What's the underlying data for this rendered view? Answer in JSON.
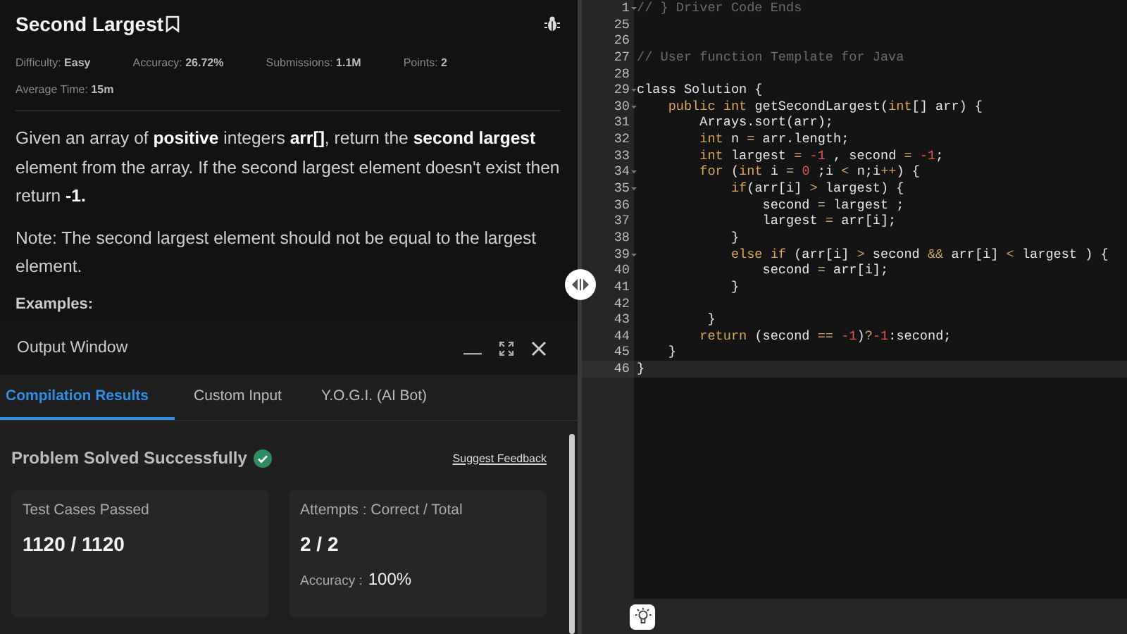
{
  "problem": {
    "title": "Second Largest",
    "meta": [
      {
        "label": "Difficulty:",
        "value": "Easy"
      },
      {
        "label": "Accuracy:",
        "value": "26.72%"
      },
      {
        "label": "Submissions:",
        "value": "1.1M"
      },
      {
        "label": "Points:",
        "value": "2"
      },
      {
        "label": "Average Time:",
        "value": "15m"
      }
    ],
    "paragraphs": [
      "Given an array of **positive** integers **arr[]**, return the **second largest** element from the array. If the second largest element doesn't exist then return **-1.**",
      "Note: The second largest element should not be equal to the largest element."
    ],
    "section_heading": "Examples:"
  },
  "output_window": {
    "title": "Output Window",
    "tabs": [
      {
        "label": "Compilation Results",
        "selected": true
      },
      {
        "label": "Custom Input",
        "selected": false
      },
      {
        "label": "Y.O.G.I. (AI Bot)",
        "selected": false
      }
    ],
    "status": "Problem Solved Successfully",
    "feedback_link": "Suggest Feedback",
    "cards": [
      {
        "label": "Test Cases Passed",
        "value": "1120 / 1120"
      },
      {
        "label": "Attempts : Correct / Total",
        "value": "2 / 2",
        "sub_label": "Accuracy :",
        "sub_value": "100%"
      }
    ]
  },
  "editor": {
    "lines": [
      {
        "n": "1",
        "fold": true,
        "current": false,
        "tokens": [
          {
            "color": "#6b6b6b",
            "t": "// } Driver Code Ends"
          }
        ]
      },
      {
        "n": "25",
        "fold": false,
        "current": false
      },
      {
        "n": "26",
        "fold": false,
        "current": false
      },
      {
        "n": "27",
        "fold": false,
        "current": false,
        "tokens": [
          {
            "color": "#6b6b6b",
            "t": "// User function Template for Java"
          }
        ]
      },
      {
        "n": "28",
        "fold": false,
        "current": false
      },
      {
        "n": "29",
        "fold": true,
        "current": false,
        "tokens": [
          {
            "color": "#e6e6e6",
            "t": "class Solution {"
          }
        ]
      },
      {
        "n": "30",
        "fold": true,
        "current": false,
        "tokens": [
          {
            "color": "#d9a95b",
            "t": "    public int"
          },
          {
            "color": "#e6e6e6",
            "t": " getSecondLargest("
          },
          {
            "color": "#d9a95b",
            "t": "int"
          },
          {
            "color": "#e6e6e6",
            "t": "[] arr) {"
          }
        ]
      },
      {
        "n": "31",
        "fold": false,
        "current": false,
        "tokens": [
          {
            "color": "#e6e6e6",
            "t": "        Arrays.sort(arr);"
          }
        ]
      },
      {
        "n": "32",
        "fold": false,
        "current": false,
        "tokens": [
          {
            "color": "#d9a95b",
            "t": "        int"
          },
          {
            "color": "#e6e6e6",
            "t": " n "
          },
          {
            "color": "#c9a36b",
            "t": "="
          },
          {
            "color": "#e6e6e6",
            "t": " arr.length;"
          }
        ]
      },
      {
        "n": "33",
        "fold": false,
        "current": false,
        "tokens": [
          {
            "color": "#d9a95b",
            "t": "        int"
          },
          {
            "color": "#e6e6e6",
            "t": " largest "
          },
          {
            "color": "#c9a36b",
            "t": "="
          },
          {
            "color": "#e05a4e",
            "t": " -1"
          },
          {
            "color": "#e6e6e6",
            "t": " , second "
          },
          {
            "color": "#c9a36b",
            "t": "="
          },
          {
            "color": "#e05a4e",
            "t": " -1"
          },
          {
            "color": "#e6e6e6",
            "t": ";"
          }
        ]
      },
      {
        "n": "34",
        "fold": true,
        "current": false,
        "tokens": [
          {
            "color": "#d9a95b",
            "t": "        for"
          },
          {
            "color": "#e6e6e6",
            "t": " ("
          },
          {
            "color": "#d9a95b",
            "t": "int"
          },
          {
            "color": "#e6e6e6",
            "t": " i "
          },
          {
            "color": "#c9a36b",
            "t": "="
          },
          {
            "color": "#e05a4e",
            "t": " 0"
          },
          {
            "color": "#e6e6e6",
            "t": " ;i "
          },
          {
            "color": "#c9a36b",
            "t": "<"
          },
          {
            "color": "#e6e6e6",
            "t": " n;i"
          },
          {
            "color": "#c9a36b",
            "t": "++"
          },
          {
            "color": "#e6e6e6",
            "t": ") {"
          }
        ]
      },
      {
        "n": "35",
        "fold": true,
        "current": false,
        "tokens": [
          {
            "color": "#d9a95b",
            "t": "            if"
          },
          {
            "color": "#e6e6e6",
            "t": "(arr[i] "
          },
          {
            "color": "#c9a36b",
            "t": ">"
          },
          {
            "color": "#e6e6e6",
            "t": " largest) {"
          }
        ]
      },
      {
        "n": "36",
        "fold": false,
        "current": false,
        "tokens": [
          {
            "color": "#e6e6e6",
            "t": "                second "
          },
          {
            "color": "#c9a36b",
            "t": "="
          },
          {
            "color": "#e6e6e6",
            "t": " largest ;"
          }
        ]
      },
      {
        "n": "37",
        "fold": false,
        "current": false,
        "tokens": [
          {
            "color": "#e6e6e6",
            "t": "                largest "
          },
          {
            "color": "#c9a36b",
            "t": "="
          },
          {
            "color": "#e6e6e6",
            "t": " arr[i];"
          }
        ]
      },
      {
        "n": "38",
        "fold": false,
        "current": false,
        "tokens": [
          {
            "color": "#e6e6e6",
            "t": "            }"
          }
        ]
      },
      {
        "n": "39",
        "fold": true,
        "current": false,
        "tokens": [
          {
            "color": "#d9a95b",
            "t": "            else if"
          },
          {
            "color": "#e6e6e6",
            "t": " (arr[i] "
          },
          {
            "color": "#c9a36b",
            "t": ">"
          },
          {
            "color": "#e6e6e6",
            "t": " second "
          },
          {
            "color": "#c9a36b",
            "t": "&&"
          },
          {
            "color": "#e6e6e6",
            "t": " arr[i] "
          },
          {
            "color": "#c9a36b",
            "t": "<"
          },
          {
            "color": "#e6e6e6",
            "t": " largest ) {"
          }
        ]
      },
      {
        "n": "40",
        "fold": false,
        "current": false,
        "tokens": [
          {
            "color": "#e6e6e6",
            "t": "                second "
          },
          {
            "color": "#c9a36b",
            "t": "="
          },
          {
            "color": "#e6e6e6",
            "t": " arr[i];"
          }
        ]
      },
      {
        "n": "41",
        "fold": false,
        "current": false,
        "tokens": [
          {
            "color": "#e6e6e6",
            "t": "            }"
          }
        ]
      },
      {
        "n": "42",
        "fold": false,
        "current": false
      },
      {
        "n": "43",
        "fold": false,
        "current": false,
        "tokens": [
          {
            "color": "#e6e6e6",
            "t": "         }"
          }
        ]
      },
      {
        "n": "44",
        "fold": false,
        "current": false,
        "tokens": [
          {
            "color": "#d9a95b",
            "t": "        return"
          },
          {
            "color": "#e6e6e6",
            "t": " (second "
          },
          {
            "color": "#c9a36b",
            "t": "=="
          },
          {
            "color": "#e05a4e",
            "t": " -1"
          },
          {
            "color": "#e6e6e6",
            "t": ")"
          },
          {
            "color": "#c9a36b",
            "t": "?"
          },
          {
            "color": "#e05a4e",
            "t": "-1"
          },
          {
            "color": "#e6e6e6",
            "t": ":second;"
          }
        ]
      },
      {
        "n": "45",
        "fold": false,
        "current": false,
        "tokens": [
          {
            "color": "#e6e6e6",
            "t": "    }"
          }
        ]
      },
      {
        "n": "46",
        "fold": false,
        "current": true,
        "tokens": [
          {
            "color": "#e6e6e6",
            "t": "}"
          }
        ]
      }
    ]
  }
}
